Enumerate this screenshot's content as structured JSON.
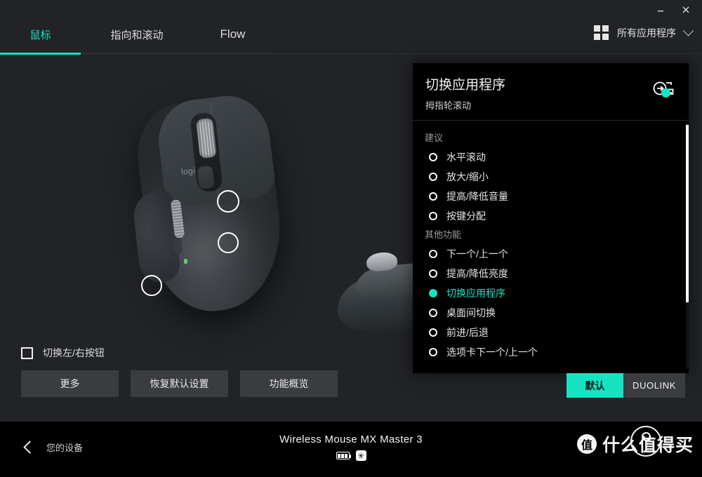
{
  "window": {
    "minimize_label": "−",
    "close_label": "✕"
  },
  "tabs": [
    {
      "label": "鼠标",
      "active": true
    },
    {
      "label": "指向和滚动",
      "active": false
    },
    {
      "label": "Flow",
      "active": false
    }
  ],
  "header": {
    "grid_icon": "grid-icon",
    "apps_label": "所有应用程序",
    "chevron": "chevron-down-icon"
  },
  "stage": {
    "device_illustration": "logitech-mx-master-3-mouse",
    "logo_text": "logi",
    "hotspots": [
      {
        "name": "scroll-wheel"
      },
      {
        "name": "mode-shift-button"
      },
      {
        "name": "thumb-wheel"
      }
    ]
  },
  "swap": {
    "label": "切换左/右按钮",
    "checked": false
  },
  "buttons": [
    {
      "label": "更多"
    },
    {
      "label": "恢复默认设置"
    },
    {
      "label": "功能概览"
    }
  ],
  "panel": {
    "title": "切换应用程序",
    "subtitle": "拇指轮滚动",
    "icon": "app-switch-icon",
    "badge_color": "#17e3c2",
    "groups": [
      {
        "label": "建议",
        "options": [
          {
            "label": "水平滚动",
            "selected": false
          },
          {
            "label": "放大/缩小",
            "selected": false
          },
          {
            "label": "提高/降低音量",
            "selected": false
          },
          {
            "label": "按键分配",
            "selected": false
          }
        ]
      },
      {
        "label": "其他功能",
        "options": [
          {
            "label": "下一个/上一个",
            "selected": false
          },
          {
            "label": "提高/降低亮度",
            "selected": false
          },
          {
            "label": "切换应用程序",
            "selected": true
          },
          {
            "label": "桌面间切换",
            "selected": false
          },
          {
            "label": "前进/后退",
            "selected": false
          },
          {
            "label": "选项卡下一个/上一个",
            "selected": false
          }
        ]
      }
    ]
  },
  "toggle": {
    "default_label": "默认",
    "duolink_label": "DUOLINK",
    "active": "默认"
  },
  "bottom": {
    "back_label": "您的设备",
    "device_name": "Wireless Mouse MX Master 3",
    "battery_icon": "battery-icon",
    "bluetooth_icon": "unifying-icon"
  },
  "watermark": {
    "badge": "值",
    "text": "什么值得买"
  },
  "colors": {
    "accent": "#17e3c2",
    "app_bg": "#212326",
    "panel_bg": "#000000",
    "button_bg": "#3a3c3f"
  }
}
